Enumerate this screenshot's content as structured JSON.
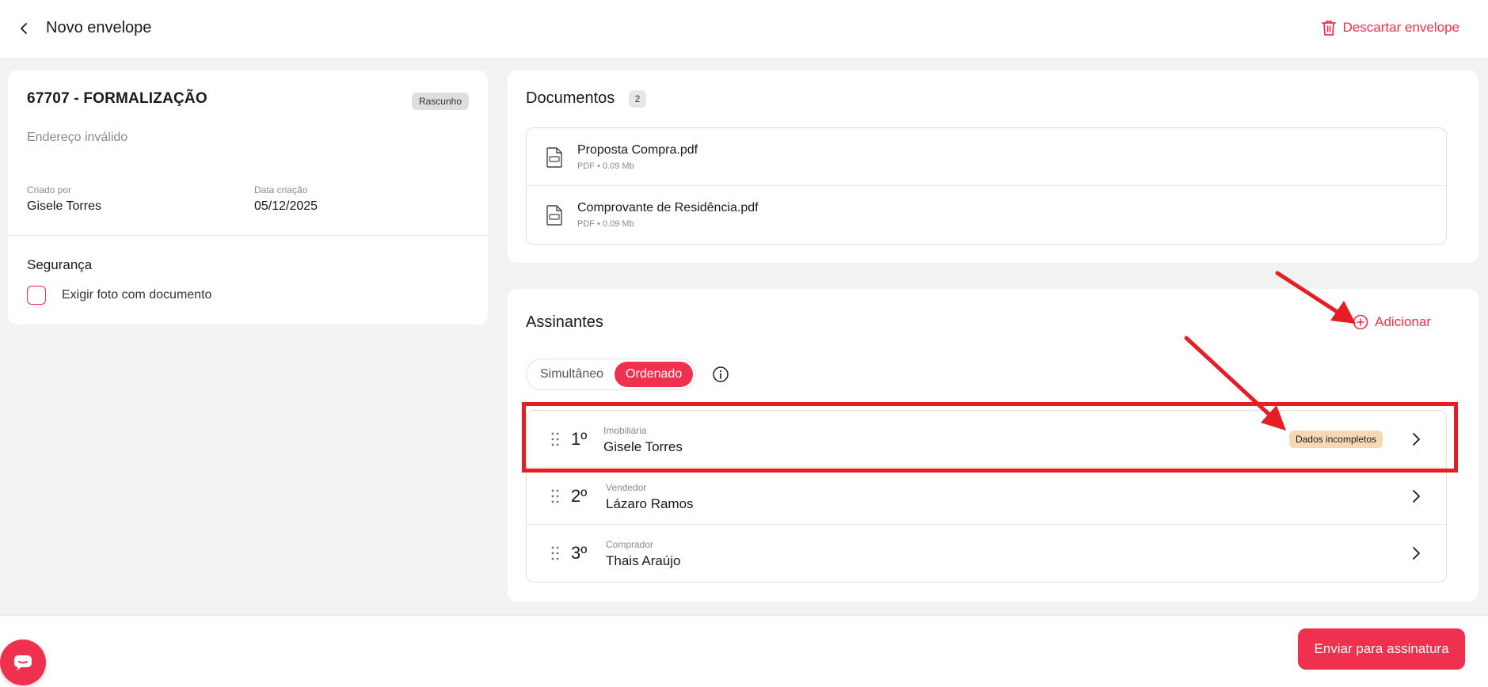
{
  "header": {
    "title": "Novo envelope",
    "discard_label": "Descartar envelope"
  },
  "envelope": {
    "title": "67707 - FORMALIZAÇÃO",
    "status": "Rascunho",
    "address": "Endereço inválido",
    "created_by_label": "Criado por",
    "created_by": "Gisele Torres",
    "created_date_label": "Data criação",
    "created_date": "05/12/2025",
    "security_title": "Segurança",
    "photo_requirement_label": "Exigir foto com documento"
  },
  "documents": {
    "title": "Documentos",
    "count": "2",
    "items": [
      {
        "name": "Proposta Compra.pdf",
        "meta": "PDF • 0.09 Mb"
      },
      {
        "name": "Comprovante de Residência.pdf",
        "meta": "PDF • 0.09 Mb"
      }
    ]
  },
  "signers": {
    "title": "Assinantes",
    "add_label": "Adicionar",
    "mode_options": [
      "Simultâneo",
      "Ordenado"
    ],
    "mode_selected": "Ordenado",
    "items": [
      {
        "order": "1º",
        "role": "Imobiliária",
        "name": "Gisele Torres",
        "badge": "Dados incompletos"
      },
      {
        "order": "2º",
        "role": "Vendedor",
        "name": "Lázaro Ramos"
      },
      {
        "order": "3º",
        "role": "Comprador",
        "name": "Thais Araújo"
      }
    ]
  },
  "footer": {
    "send_label": "Enviar para assinatura"
  },
  "colors": {
    "accent": "#f0304f",
    "annotation": "#e51d24",
    "warning_badge": "#f5d9b4"
  }
}
